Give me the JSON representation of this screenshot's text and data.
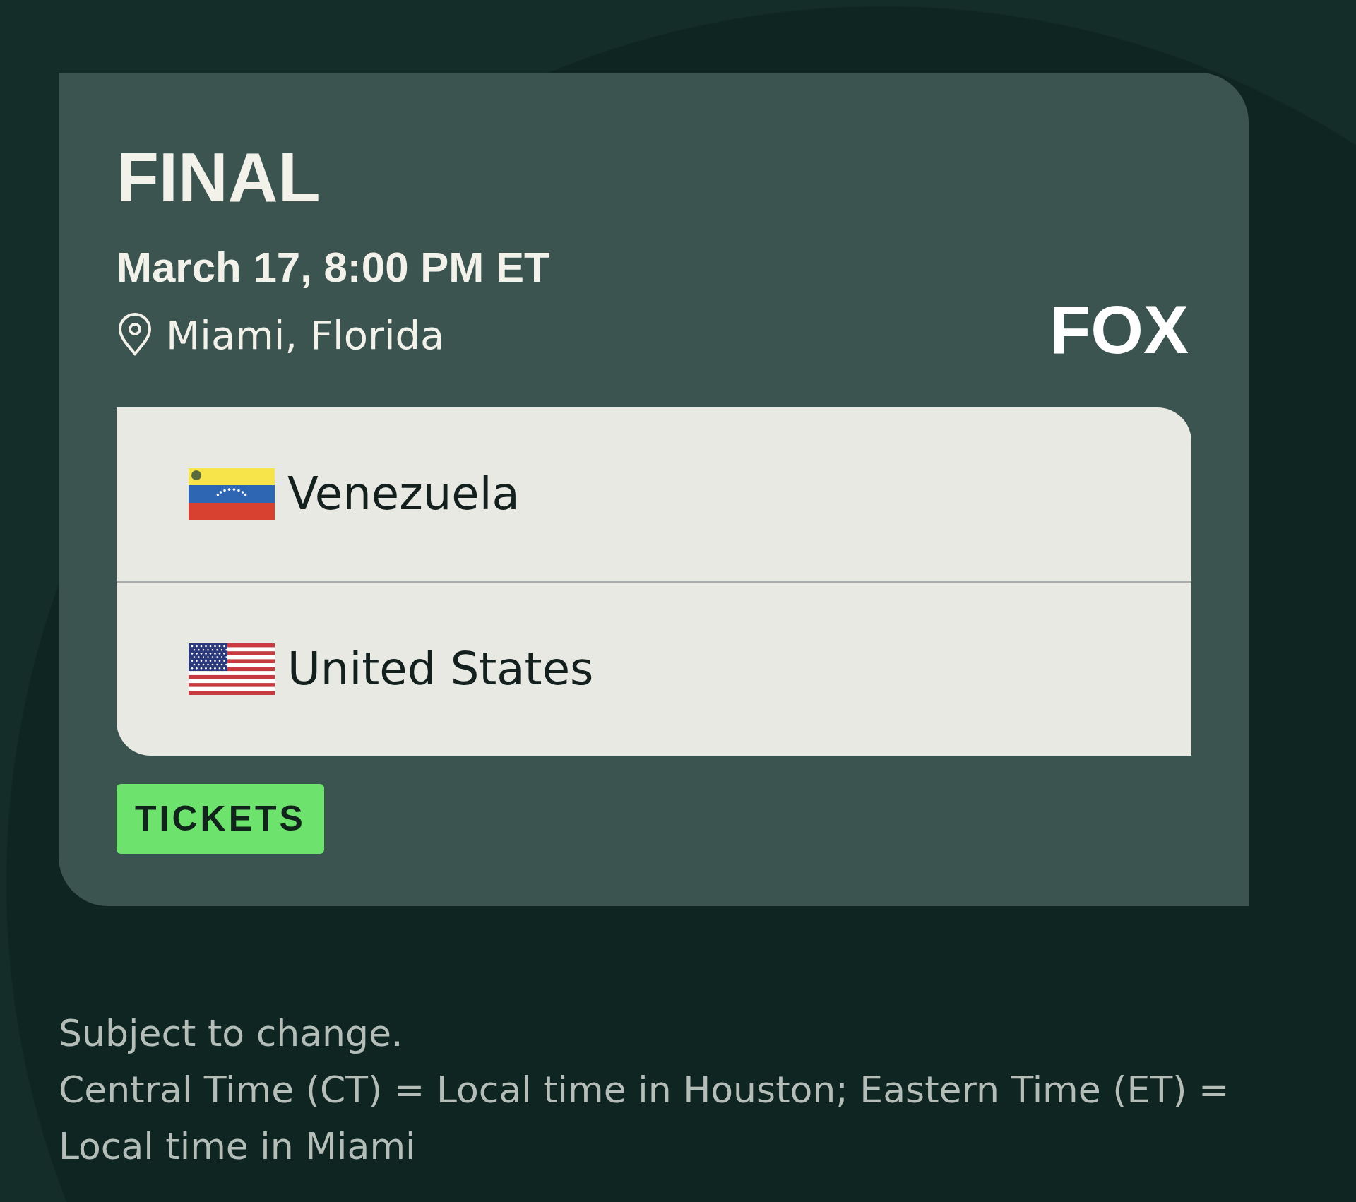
{
  "card": {
    "title": "FINAL",
    "datetime": "March 17, 8:00 PM ET",
    "location": "Miami, Florida",
    "network": "FOX",
    "teams": [
      {
        "name": "Venezuela",
        "kind": "venezuela"
      },
      {
        "name": "United States",
        "kind": "usa"
      }
    ],
    "button": "TICKETS"
  },
  "notes": [
    "Subject to change.",
    "Central Time (CT) = Local time in Houston; Eastern Time (ET) = Local time in Miami"
  ]
}
